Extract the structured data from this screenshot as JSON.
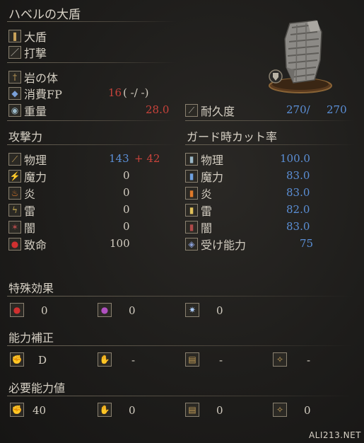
{
  "title": "ハベルの大盾",
  "item_info": {
    "weapon_type": "大盾",
    "attack_type": "打撃",
    "skill": "岩の体",
    "fp_label": "消費FP",
    "fp_cost": "16",
    "fp_extra": "( -/ -)",
    "weight_label": "重量",
    "weight": "28.0",
    "durability_label": "耐久度",
    "durability_current": "270/",
    "durability_max": "270"
  },
  "attack": {
    "heading": "攻撃力",
    "rows": [
      {
        "label": "物理",
        "value": "143",
        "bonus": "+ 42",
        "icon": "physical-icon"
      },
      {
        "label": "魔力",
        "value": "0",
        "icon": "magic-icon"
      },
      {
        "label": "炎",
        "value": "0",
        "icon": "fire-icon"
      },
      {
        "label": "雷",
        "value": "0",
        "icon": "lightning-icon"
      },
      {
        "label": "闇",
        "value": "0",
        "icon": "dark-icon"
      },
      {
        "label": "致命",
        "value": "100",
        "icon": "critical-icon"
      }
    ]
  },
  "guard": {
    "heading": "ガード時カット率",
    "rows": [
      {
        "label": "物理",
        "value": "100.0",
        "icon": "physical-guard-icon"
      },
      {
        "label": "魔力",
        "value": "83.0",
        "icon": "magic-guard-icon"
      },
      {
        "label": "炎",
        "value": "83.0",
        "icon": "fire-guard-icon"
      },
      {
        "label": "雷",
        "value": "82.0",
        "icon": "lightning-guard-icon"
      },
      {
        "label": "闇",
        "value": "83.0",
        "icon": "dark-guard-icon"
      },
      {
        "label": "受け能力",
        "value": "75",
        "icon": "stability-icon"
      }
    ]
  },
  "special": {
    "heading": "特殊効果",
    "values": [
      "0",
      "0",
      "0"
    ]
  },
  "scaling": {
    "heading": "能力補正",
    "values": [
      "D",
      "-",
      "-",
      "-"
    ]
  },
  "requirements": {
    "heading": "必要能力値",
    "values": [
      "40",
      "0",
      "0",
      "0"
    ]
  },
  "watermark": "ALI213.NET",
  "colors": {
    "blue": "#5b8fd6",
    "red": "#c8433b",
    "text": "#d3cdc1"
  }
}
